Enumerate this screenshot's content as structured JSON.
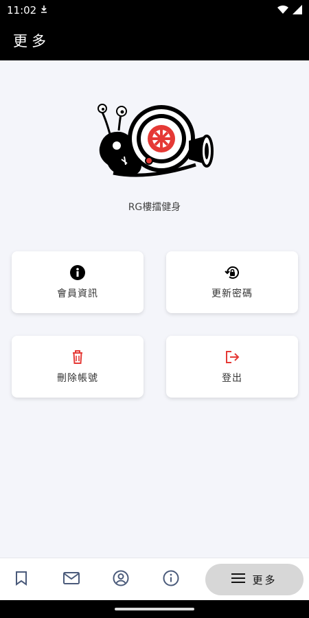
{
  "status": {
    "time": "11:02"
  },
  "app_bar": {
    "title": "更多"
  },
  "brand": {
    "name": "RG樓擂健身"
  },
  "cards": [
    {
      "label": "會員資訊",
      "icon": "info-icon"
    },
    {
      "label": "更新密碼",
      "icon": "lock-reset-icon"
    },
    {
      "label": "刪除帳號",
      "icon": "trash-icon"
    },
    {
      "label": "登出",
      "icon": "logout-icon"
    }
  ],
  "bottom_nav": {
    "items": [
      "bookmark-icon",
      "mail-icon",
      "account-icon",
      "info-icon"
    ],
    "active": {
      "label": "更多",
      "icon": "menu-icon"
    }
  },
  "colors": {
    "accent_red": "#e53935",
    "active_pill": "#d7d7d7"
  }
}
